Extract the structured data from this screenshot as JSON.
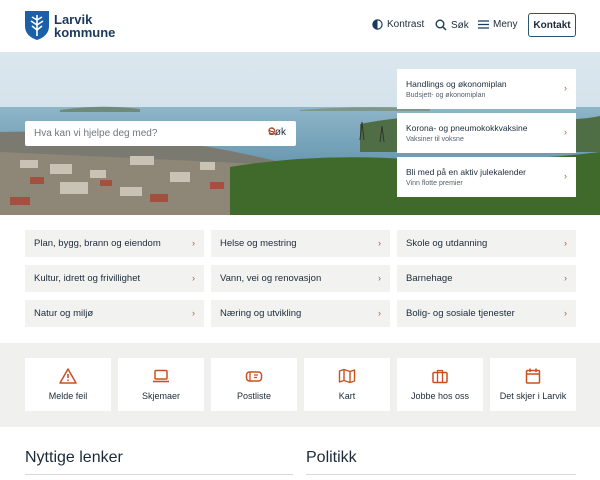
{
  "brand": {
    "line1": "Larvik",
    "line2": "kommune"
  },
  "header": {
    "contrast_label": "Kontrast",
    "search_label": "Søk",
    "menu_label": "Meny",
    "contact_label": "Kontakt"
  },
  "hero": {
    "search_placeholder": "Hva kan vi hjelpe deg med?",
    "search_button": "Søk",
    "cards": [
      {
        "title": "Handlings og økonomiplan",
        "subtitle": "Budsjett- og økonomiplan"
      },
      {
        "title": "Korona- og pneumokokkvaksine",
        "subtitle": "Vaksiner til voksne"
      },
      {
        "title": "Bli med på en aktiv julekalender",
        "subtitle": "Vinn flotte premier"
      }
    ]
  },
  "categories": [
    "Plan, bygg, brann og eiendom",
    "Helse og mestring",
    "Skole og utdanning",
    "Kultur, idrett og frivillighet",
    "Vann, vei og renovasjon",
    "Barnehage",
    "Natur og miljø",
    "Næring og utvikling",
    "Bolig- og sosiale tjenester"
  ],
  "quick_links": [
    {
      "label": "Melde feil",
      "icon": "warning-icon"
    },
    {
      "label": "Skjemaer",
      "icon": "laptop-icon"
    },
    {
      "label": "Postliste",
      "icon": "mailbox-icon"
    },
    {
      "label": "Kart",
      "icon": "map-icon"
    },
    {
      "label": "Jobbe hos oss",
      "icon": "briefcase-icon"
    },
    {
      "label": "Det skjer i Larvik",
      "icon": "calendar-icon"
    }
  ],
  "sections": {
    "useful_links": "Nyttige lenker",
    "politics": "Politikk"
  },
  "colors": {
    "accent": "#c8521f",
    "navy": "#1a3a5c",
    "panel": "#f2f2f1"
  }
}
